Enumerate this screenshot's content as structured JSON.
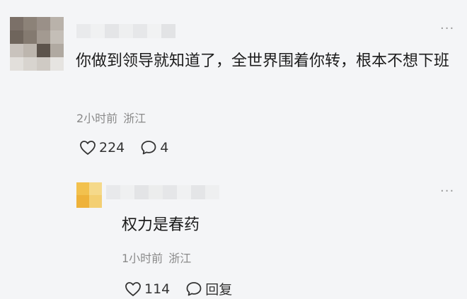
{
  "comments": [
    {
      "text": "你做到领导就知道了，全世界围着你转，根本不想下班",
      "time": "2小时前",
      "location": "浙江",
      "likes": "224",
      "replies": "4",
      "more_icon": "more-horizontal-icon"
    },
    {
      "text": "权力是春药",
      "time": "1小时前",
      "location": "浙江",
      "likes": "114",
      "reply_label": "回复",
      "more_icon": "more-horizontal-icon"
    }
  ],
  "icons": {
    "like": "heart-outline-icon",
    "comment": "speech-bubble-icon",
    "more": "more-horizontal-icon"
  },
  "colors": {
    "background": "#f4f5f7",
    "text": "#1c1c1c",
    "meta": "#8a8a8a",
    "icon": "#333333"
  }
}
